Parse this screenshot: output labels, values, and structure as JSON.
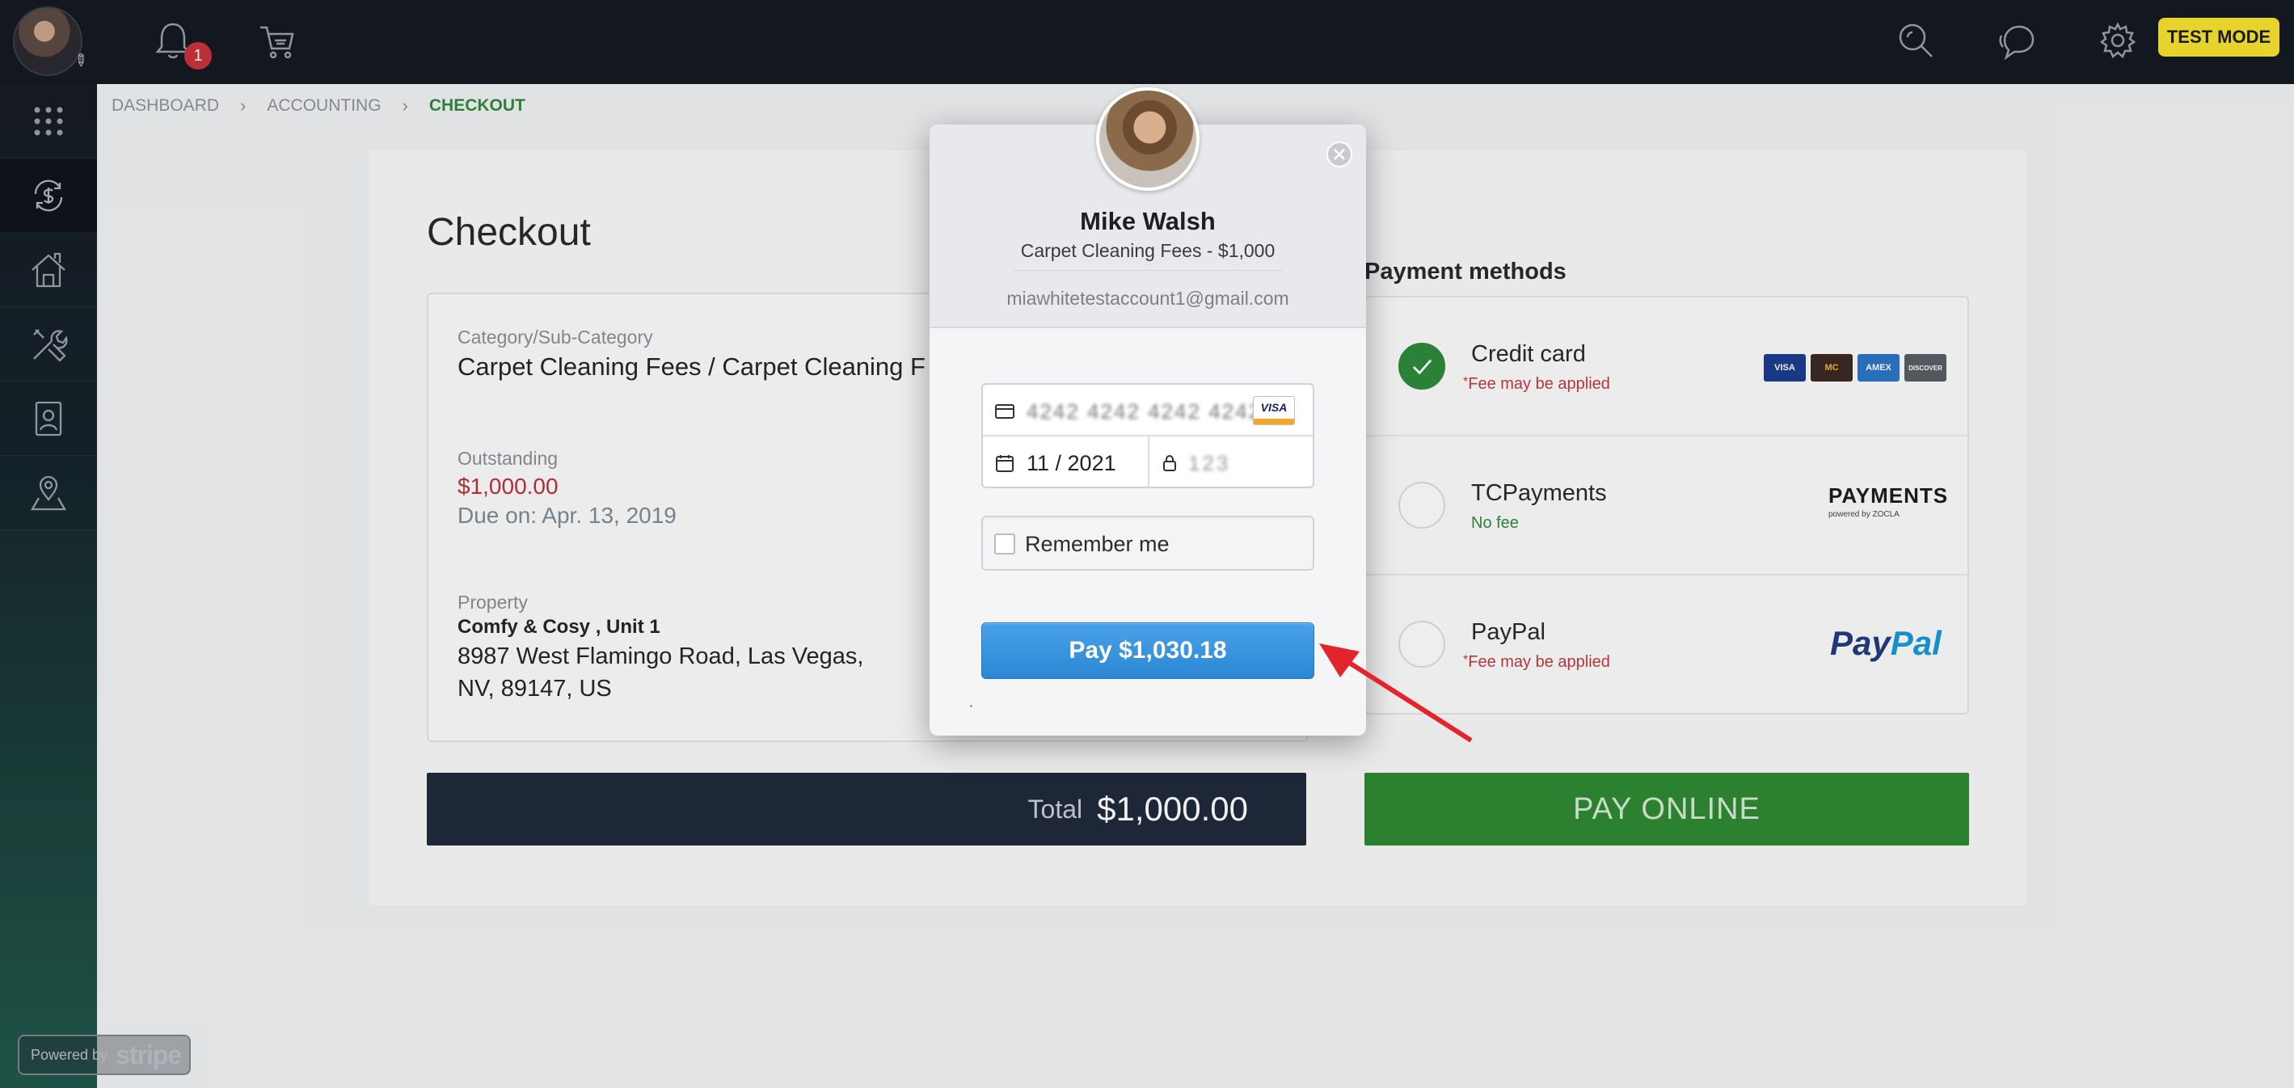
{
  "topbar": {
    "notification_count": "1",
    "test_mode_label": "TEST MODE",
    "icons": [
      "bell-icon",
      "cart-icon",
      "search-icon",
      "chat-icon",
      "gear-icon"
    ]
  },
  "sidebar": {
    "items": [
      "apps-grid-icon",
      "accounting-icon",
      "property-icon",
      "maintenance-icon",
      "tenant-icon",
      "location-icon"
    ],
    "active_index": 1,
    "powered_by": "Powered by",
    "powered_brand": "stripe"
  },
  "breadcrumb": {
    "items": [
      "DASHBOARD",
      "ACCOUNTING",
      "CHECKOUT"
    ],
    "separator": "›"
  },
  "checkout": {
    "title": "Checkout",
    "category_label": "Category/Sub-Category",
    "category_value": "Carpet Cleaning Fees / Carpet Cleaning F",
    "outstanding_label": "Outstanding",
    "outstanding_amount": "$1,000.00",
    "due_date": "Due on: Apr. 13, 2019",
    "property_label": "Property",
    "property_name": "Comfy & Cosy , Unit 1",
    "property_address_line1": "8987 West Flamingo Road, Las Vegas,",
    "property_address_line2": "NV, 89147, US",
    "total_label": "Total",
    "total_value": "$1,000.00"
  },
  "payment_methods": {
    "title": "Payment methods",
    "options": [
      {
        "name": "Credit card",
        "note": "Fee may be applied",
        "selected": true
      },
      {
        "name": "TCPayments",
        "note": "No fee",
        "selected": false
      },
      {
        "name": "PayPal",
        "note": "Fee may be applied",
        "selected": false
      }
    ],
    "card_brands": [
      "VISA",
      "MC",
      "AMEX",
      "DISCOVER"
    ],
    "tcpayments_logo": "PAYMENTS",
    "tcpayments_logo_sub": "powered by ZOCLA",
    "paypal_logo_a": "Pay",
    "paypal_logo_b": "Pal",
    "pay_online_label": "PAY ONLINE"
  },
  "stripe_modal": {
    "name": "Mike Walsh",
    "description": "Carpet Cleaning Fees - $1,000",
    "email": "miawhitetestaccount1@gmail.com",
    "card_number": "4242 4242 4242 4242",
    "card_brand": "VISA",
    "expiry": "11 / 2021",
    "cvc": "123",
    "remember_label": "Remember me",
    "pay_button_label": "Pay $1,030.18"
  },
  "colors": {
    "accent_green": "#2f8a35",
    "pay_blue": "#2b86d4",
    "alert_red": "#c2393f",
    "test_mode_yellow": "#f5e12f",
    "dark_bar": "#1f2a3c"
  }
}
